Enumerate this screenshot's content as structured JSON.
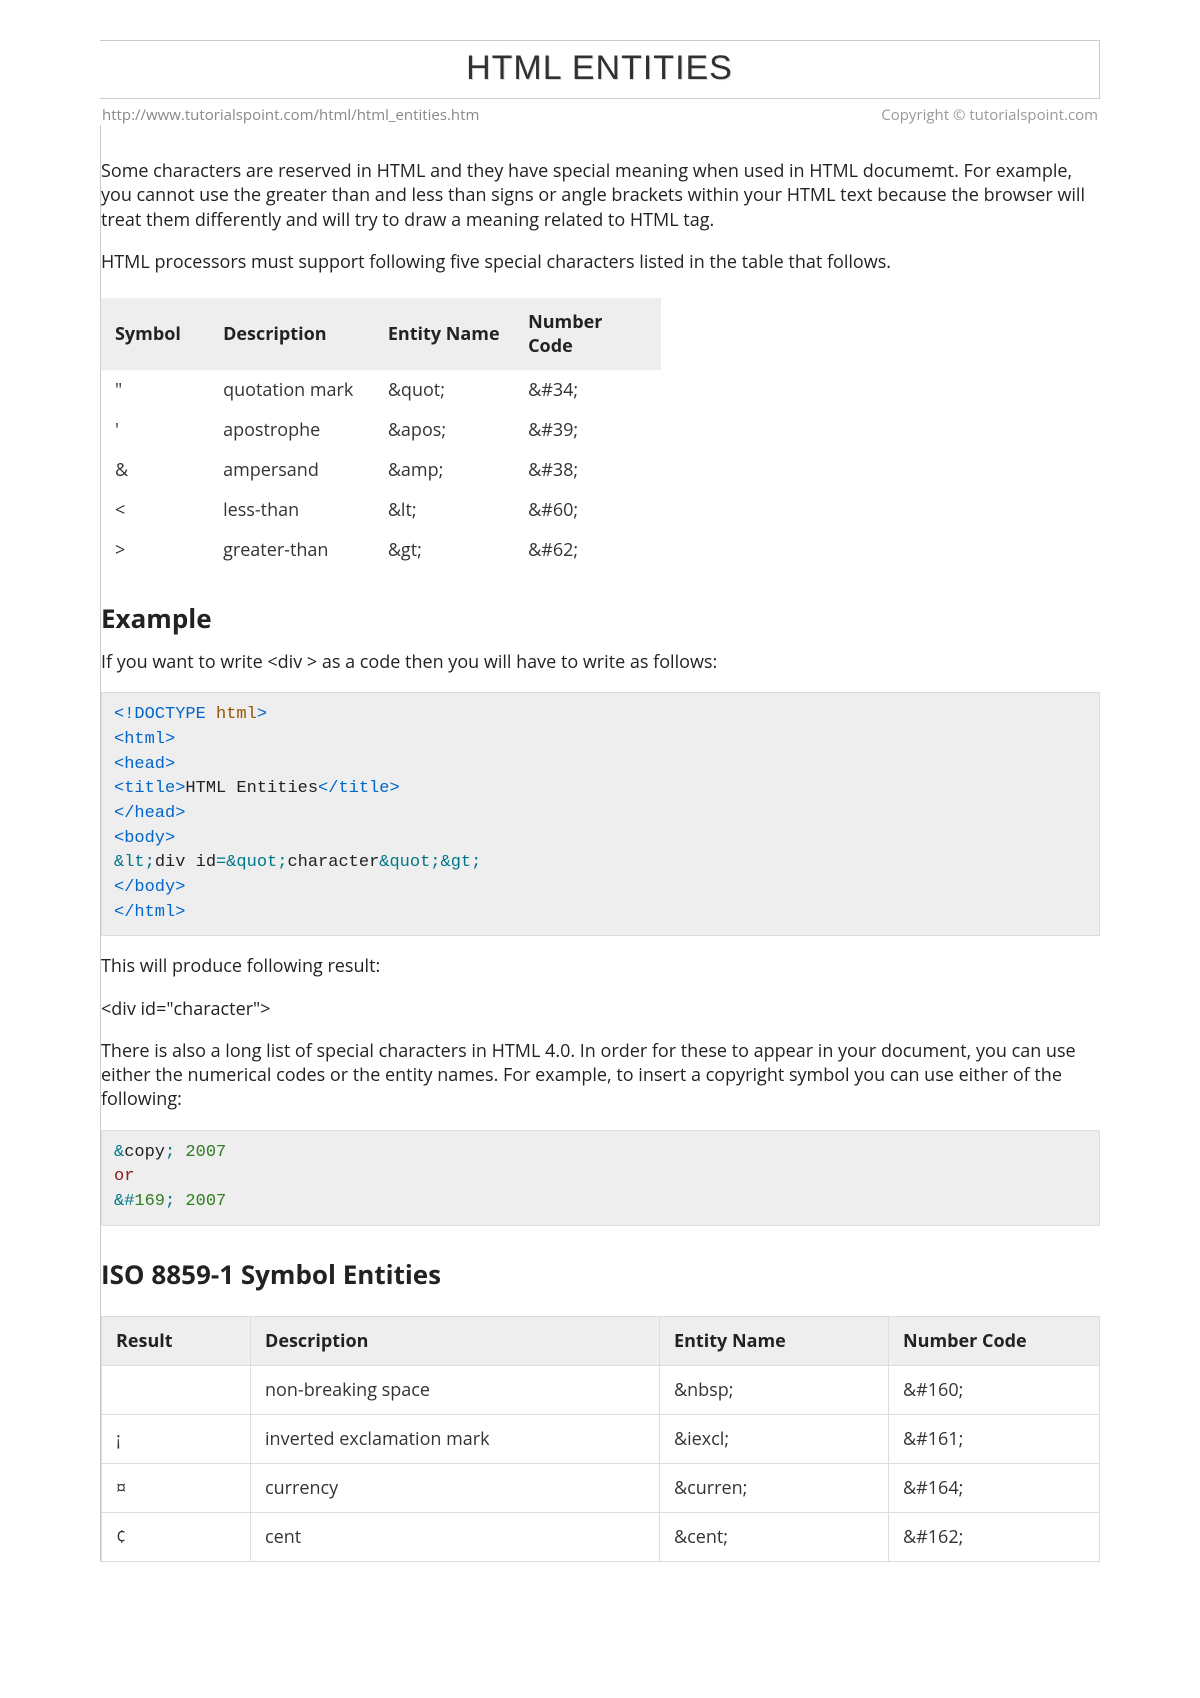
{
  "header": {
    "title": "HTML ENTITIES",
    "url": "http://www.tutorialspoint.com/html/html_entities.htm",
    "copyright": "Copyright © tutorialspoint.com"
  },
  "intro_p1": "Some characters are reserved in HTML and they have special meaning when used in HTML documemt. For example, you cannot use the greater than and less than signs or angle brackets within your HTML text because the browser will treat them differently and will try to draw a meaning related to HTML tag.",
  "intro_p2": "HTML processors must support following five special characters listed in the table that follows.",
  "table1": {
    "headers": {
      "c1": "Symbol",
      "c2": "Description",
      "c3": "Entity Name",
      "c4": "Number Code"
    },
    "rows": [
      {
        "sym": "\"",
        "desc": "quotation mark",
        "name": "&quot;",
        "num": "&#34;"
      },
      {
        "sym": "'",
        "desc": "apostrophe",
        "name": "&apos;",
        "num": "&#39;"
      },
      {
        "sym": "&",
        "desc": "ampersand",
        "name": "&amp;",
        "num": "&#38;"
      },
      {
        "sym": "<",
        "desc": "less-than",
        "name": "&lt;",
        "num": "&#60;"
      },
      {
        "sym": ">",
        "desc": "greater-than",
        "name": "&gt;",
        "num": "&#62;"
      }
    ]
  },
  "example": {
    "heading": "Example",
    "lead": "If you want to write <div > as a code then you will have to write as follows:",
    "result_lead": "This will produce following result:",
    "result_code": "<div id=\"character\">",
    "long_note": "There is also a long list of special characters in HTML 4.0. In order for these to appear in your document, you can use either the numerical codes or the entity names. For example, to insert a copyright symbol you can use either of the following:"
  },
  "code1": {
    "l1a": "<!DOCTYPE",
    "l1b": " html",
    "l1c": ">",
    "l2": "<html>",
    "l3": "<head>",
    "l4a": "<title>",
    "l4b": "HTML Entities",
    "l4c": "</title>",
    "l5": "</head>",
    "l6": "<body>",
    "l7a": "&lt;",
    "l7b": "div id",
    "l7c": "=&quot;",
    "l7d": "character",
    "l7e": "&quot;&gt;",
    "l8": "</body>",
    "l9": "</html>"
  },
  "code2": {
    "l1a": "&",
    "l1b": "copy",
    "l1c": ";",
    "l1d": " 2007",
    "l2": "or",
    "l3a": "&#",
    "l3b": "169",
    "l3c": ";",
    "l3d": " 2007"
  },
  "iso": {
    "heading": "ISO 8859-1 Symbol Entities",
    "headers": {
      "c1": "Result",
      "c2": "Description",
      "c3": "Entity Name",
      "c4": "Number Code"
    },
    "rows": [
      {
        "sym": "",
        "desc": "non-breaking space",
        "name": "&nbsp;",
        "num": "&#160;"
      },
      {
        "sym": "¡",
        "desc": "inverted exclamation mark",
        "name": "&iexcl;",
        "num": "&#161;"
      },
      {
        "sym": "¤",
        "desc": "currency",
        "name": "&curren;",
        "num": "&#164;"
      },
      {
        "sym": "¢",
        "desc": "cent",
        "name": "&cent;",
        "num": "&#162;"
      }
    ]
  }
}
